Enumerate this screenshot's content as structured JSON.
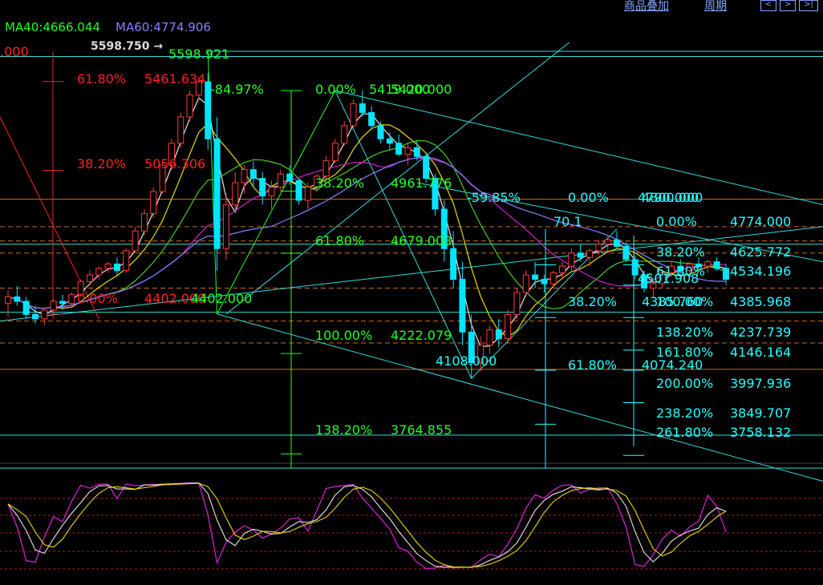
{
  "toolbar": {
    "add_product": "商品叠加",
    "period": "周期",
    "nav_prev": "<",
    "nav_next": ">",
    "nav_last": ">|"
  },
  "ma_labels": {
    "ma40": "MA40:4666.044",
    "ma60": "MA60:4774.906"
  },
  "colors": {
    "background": "#000000",
    "candle_up": "#ff3b3b",
    "candle_down": "#00e5ff",
    "fib_red": "#ff2020",
    "fib_green": "#22ff22",
    "fib_cyan": "#22ffff",
    "channel": "#33dddd",
    "orange_dash": "#cc6a1a",
    "ma_white": "#e8e8e8",
    "ma_yellow": "#e8d800",
    "ma_green": "#44cc22",
    "ma_magenta": "#cc22cc",
    "ma_purple": "#8a7fff"
  },
  "chart_data": {
    "type": "candlestick",
    "price_axis_range": [
      3700,
      5650
    ],
    "price_line_levels": [
      5575,
      4925,
      4720,
      4410,
      4150,
      3850,
      3700
    ],
    "orange_dash_levels": [
      4800,
      4735,
      4680,
      4520,
      4370,
      4270
    ],
    "candles": [
      [
        4450,
        4510,
        4390,
        4480
      ],
      [
        4480,
        4530,
        4440,
        4460
      ],
      [
        4460,
        4480,
        4380,
        4400
      ],
      [
        4400,
        4440,
        4360,
        4380
      ],
      [
        4380,
        4430,
        4350,
        4420
      ],
      [
        4420,
        4470,
        4400,
        4460
      ],
      [
        4460,
        4490,
        4420,
        4450
      ],
      [
        4450,
        4500,
        4430,
        4490
      ],
      [
        4490,
        4560,
        4480,
        4550
      ],
      [
        4550,
        4600,
        4530,
        4580
      ],
      [
        4580,
        4620,
        4560,
        4610
      ],
      [
        4610,
        4640,
        4590,
        4630
      ],
      [
        4630,
        4660,
        4580,
        4600
      ],
      [
        4600,
        4700,
        4590,
        4690
      ],
      [
        4690,
        4800,
        4680,
        4780
      ],
      [
        4780,
        4880,
        4760,
        4860
      ],
      [
        4860,
        4980,
        4840,
        4960
      ],
      [
        4960,
        5100,
        4950,
        5080
      ],
      [
        5080,
        5200,
        5060,
        5180
      ],
      [
        5180,
        5320,
        5160,
        5300
      ],
      [
        5300,
        5420,
        5280,
        5400
      ],
      [
        5400,
        5480,
        5380,
        5460
      ],
      [
        5460,
        5500,
        5150,
        5200
      ],
      [
        5200,
        5300,
        4600,
        4700
      ],
      [
        4700,
        4950,
        4650,
        4900
      ],
      [
        4900,
        5050,
        4880,
        5000
      ],
      [
        5000,
        5080,
        4950,
        5060
      ],
      [
        5060,
        5100,
        4980,
        5020
      ],
      [
        5020,
        5050,
        4900,
        4940
      ],
      [
        4940,
        5010,
        4880,
        4980
      ],
      [
        4980,
        5060,
        4960,
        5040
      ],
      [
        5040,
        5080,
        4990,
        5010
      ],
      [
        5010,
        5020,
        4900,
        4920
      ],
      [
        4920,
        5000,
        4880,
        4980
      ],
      [
        4980,
        5040,
        4960,
        5030
      ],
      [
        5030,
        5120,
        5020,
        5100
      ],
      [
        5100,
        5200,
        5090,
        5180
      ],
      [
        5180,
        5280,
        5170,
        5260
      ],
      [
        5260,
        5380,
        5250,
        5360
      ],
      [
        5360,
        5420,
        5300,
        5320
      ],
      [
        5320,
        5350,
        5240,
        5260
      ],
      [
        5260,
        5280,
        5180,
        5200
      ],
      [
        5200,
        5230,
        5150,
        5180
      ],
      [
        5180,
        5220,
        5120,
        5130
      ],
      [
        5130,
        5180,
        5080,
        5160
      ],
      [
        5160,
        5190,
        5100,
        5120
      ],
      [
        5120,
        5140,
        5000,
        5020
      ],
      [
        5020,
        5040,
        4850,
        4880
      ],
      [
        4880,
        4920,
        4640,
        4700
      ],
      [
        4700,
        4780,
        4520,
        4560
      ],
      [
        4560,
        4640,
        4260,
        4320
      ],
      [
        4320,
        4400,
        4108,
        4180
      ],
      [
        4180,
        4300,
        4140,
        4260
      ],
      [
        4260,
        4350,
        4220,
        4330
      ],
      [
        4330,
        4380,
        4250,
        4290
      ],
      [
        4290,
        4420,
        4270,
        4400
      ],
      [
        4400,
        4520,
        4380,
        4500
      ],
      [
        4500,
        4600,
        4480,
        4580
      ],
      [
        4580,
        4640,
        4520,
        4560
      ],
      [
        4560,
        4580,
        4500,
        4540
      ],
      [
        4540,
        4600,
        4520,
        4590
      ],
      [
        4590,
        4640,
        4560,
        4620
      ],
      [
        4620,
        4700,
        4600,
        4680
      ],
      [
        4680,
        4720,
        4640,
        4660
      ],
      [
        4660,
        4700,
        4620,
        4690
      ],
      [
        4690,
        4740,
        4670,
        4720
      ],
      [
        4720,
        4760,
        4690,
        4740
      ],
      [
        4740,
        4780,
        4700,
        4710
      ],
      [
        4710,
        4730,
        4640,
        4650
      ],
      [
        4650,
        4670,
        4560,
        4580
      ],
      [
        4580,
        4600,
        4500,
        4520
      ],
      [
        4520,
        4560,
        4480,
        4540
      ],
      [
        4540,
        4600,
        4520,
        4590
      ],
      [
        4590,
        4640,
        4570,
        4620
      ],
      [
        4620,
        4650,
        4590,
        4600
      ],
      [
        4600,
        4640,
        4580,
        4630
      ],
      [
        4630,
        4660,
        4600,
        4620
      ],
      [
        4620,
        4650,
        4590,
        4640
      ],
      [
        4640,
        4660,
        4600,
        4610
      ],
      [
        4610,
        4630,
        4534,
        4560
      ]
    ],
    "peak_marker": "5598.750 →",
    "fib_sets": [
      {
        "color": "red",
        "labels": [
          {
            "pct": ".000",
            "price": ""
          },
          {
            "pct": "61.80%",
            "price": "5461.634"
          },
          {
            "pct": "38.20%",
            "price": "5056.306"
          },
          {
            "pct": "0.00%",
            "price": "4402.000"
          }
        ]
      },
      {
        "color": "green",
        "labels": [
          {
            "pct": "5598.921",
            "price": ""
          },
          {
            "pct": "-84.97%",
            "price": ""
          },
          {
            "pct": "0.00%",
            "price": "5420.000"
          },
          {
            "pct": "38.20%",
            "price": "4961.776"
          },
          {
            "pct": "61.80%",
            "price": "4679.003"
          },
          {
            "pct": "100.00%",
            "price": "4222.079"
          },
          {
            "pct": "138.20%",
            "price": "3764.855"
          },
          {
            "pct": "4402.000",
            "price": ""
          },
          {
            "pct": "5419.000",
            "price": ""
          }
        ]
      },
      {
        "color": "cyan",
        "labels": [
          {
            "pct": "4108.000",
            "price": ""
          },
          {
            "pct": "-59.85%",
            "price": ""
          },
          {
            "pct": "0.00%",
            "price": "4800.000"
          },
          {
            "pct": "4790.000",
            "price": ""
          },
          {
            "pct": "70.1",
            "price": ""
          },
          {
            "pct": "0.00%",
            "price": "4774.000"
          },
          {
            "pct": "38.20%",
            "price": "4625.772"
          },
          {
            "pct": "61.80%",
            "price": "4534.196"
          },
          {
            "pct": "4501.908",
            "price": ""
          },
          {
            "pct": "38.20%",
            "price": "4385.760"
          },
          {
            "pct": "100.00%",
            "price": "4385.968"
          },
          {
            "pct": "138.20%",
            "price": "4237.739"
          },
          {
            "pct": "161.80%",
            "price": "4146.164"
          },
          {
            "pct": "61.80%",
            "price": "4074.240"
          },
          {
            "pct": "200.00%",
            "price": "3997.936"
          },
          {
            "pct": "238.20%",
            "price": "3849.707"
          },
          {
            "pct": "261.80%",
            "price": "3758.132"
          }
        ]
      }
    ]
  }
}
